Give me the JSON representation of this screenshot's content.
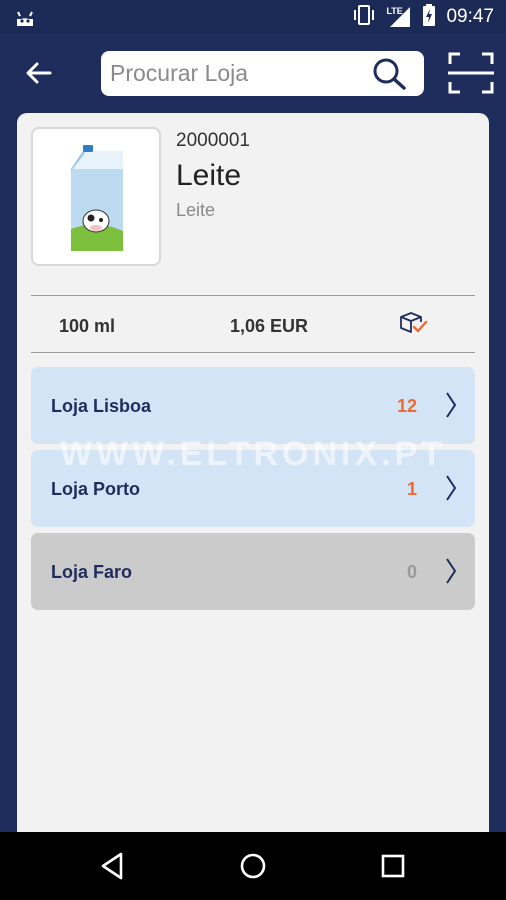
{
  "status_bar": {
    "time": "09:47",
    "network": "LTE"
  },
  "search": {
    "placeholder": "Procurar Loja"
  },
  "product": {
    "code": "2000001",
    "name": "Leite",
    "category": "Leite",
    "quantity": "100 ml",
    "price": "1,06 EUR"
  },
  "stores": [
    {
      "name": "Loja Lisboa",
      "count": "12",
      "count_color": "#ef6a2c",
      "status": "available"
    },
    {
      "name": "Loja Porto",
      "count": "1",
      "count_color": "#ef6a2c",
      "status": "available"
    },
    {
      "name": "Loja Faro",
      "count": "0",
      "count_color": "#9a9a9a",
      "status": "empty"
    }
  ],
  "watermark": "WWW.ELTRONIX.PT",
  "colors": {
    "primary": "#1f2d5c",
    "accent": "#ef6a2c",
    "available_bg": "#d4e4f7",
    "empty_bg": "#cbcbcb"
  },
  "icons": [
    "android-icon",
    "vibrate-icon",
    "signal-icon",
    "battery-icon",
    "back-arrow-icon",
    "search-icon",
    "scan-icon",
    "box-check-icon",
    "chevron-right-icon",
    "nav-back-icon",
    "nav-home-icon",
    "nav-recents-icon"
  ]
}
